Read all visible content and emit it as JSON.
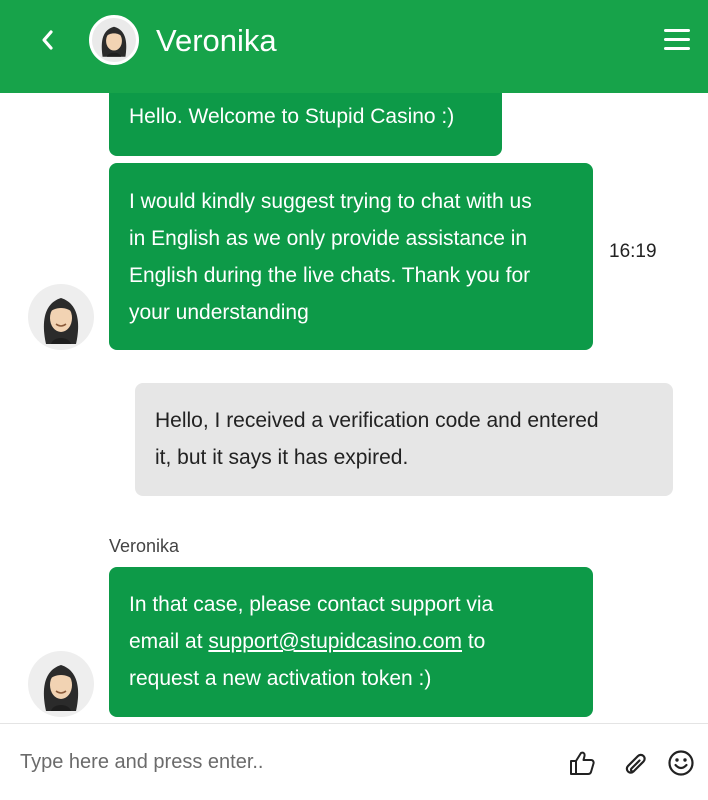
{
  "header": {
    "agent_name": "Veronika",
    "back_icon": "chevron-left-icon",
    "menu_icon": "hamburger-menu-icon",
    "color": "#17a34a"
  },
  "messages": [
    {
      "from": "agent",
      "text": "Hello. Welcome to Stupid Casino :)"
    },
    {
      "from": "agent",
      "lines": [
        "I would kindly suggest trying to chat with us",
        "in English as we only provide assistance in",
        "English during the live chats. Thank you for",
        "your understanding"
      ],
      "time": "16:19"
    },
    {
      "from": "user",
      "lines": [
        "Hello, I received a verification code and entered",
        "it, but it says it has expired."
      ]
    },
    {
      "from": "agent",
      "sender": "Veronika",
      "line1": "In that case, please contact support via",
      "line2_before": "email at ",
      "email": "support@stupidcasino.com",
      "line2_after": " to",
      "line3": "request a new activation token :)"
    }
  ],
  "composer": {
    "placeholder": "Type here and press enter..",
    "value": "",
    "icons": [
      "thumbs-up-icon",
      "paperclip-icon",
      "smiley-icon"
    ]
  },
  "colors": {
    "agent_bubble": "#0d9a48",
    "user_bubble": "#e6e6e6"
  }
}
